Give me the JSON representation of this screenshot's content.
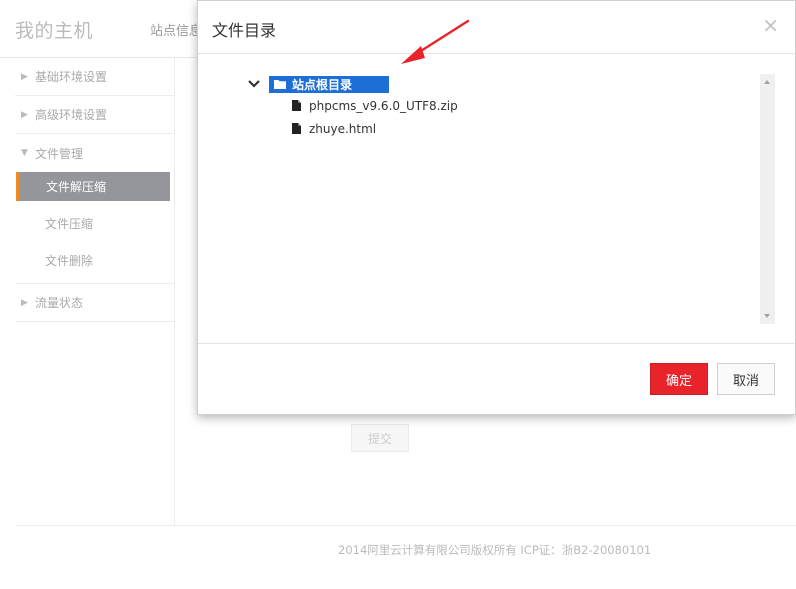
{
  "page": {
    "brand": "我的主机",
    "header_tab": "站点信息",
    "sidebar": {
      "groups": [
        {
          "label": "基础环境设置"
        },
        {
          "label": "高级环境设置"
        },
        {
          "label": "文件管理",
          "items": [
            "文件解压缩",
            "文件压缩",
            "文件删除"
          ]
        },
        {
          "label": "流量状态"
        }
      ]
    },
    "submit_label": "提交",
    "footer": "2014阿里云计算有限公司版权所有 ICP证：浙B2-20080101"
  },
  "dialog": {
    "title": "文件目录",
    "close_glyph": "×",
    "tree": {
      "root_label": "站点根目录",
      "files": [
        "phpcms_v9.6.0_UTF8.zip",
        "zhuye.html"
      ]
    },
    "ok_label": "确定",
    "cancel_label": "取消"
  },
  "colors": {
    "accent_red": "#e8242a",
    "selection_blue": "#1d6fd6",
    "active_sidebar": "#94969b",
    "sidebar_marker": "#f08a24",
    "annotation_arrow": "#e8242a"
  },
  "icons": {
    "tree_toggle": "chevron-down-icon",
    "root": "folder-icon",
    "file": "file-icon",
    "close": "close-icon"
  }
}
